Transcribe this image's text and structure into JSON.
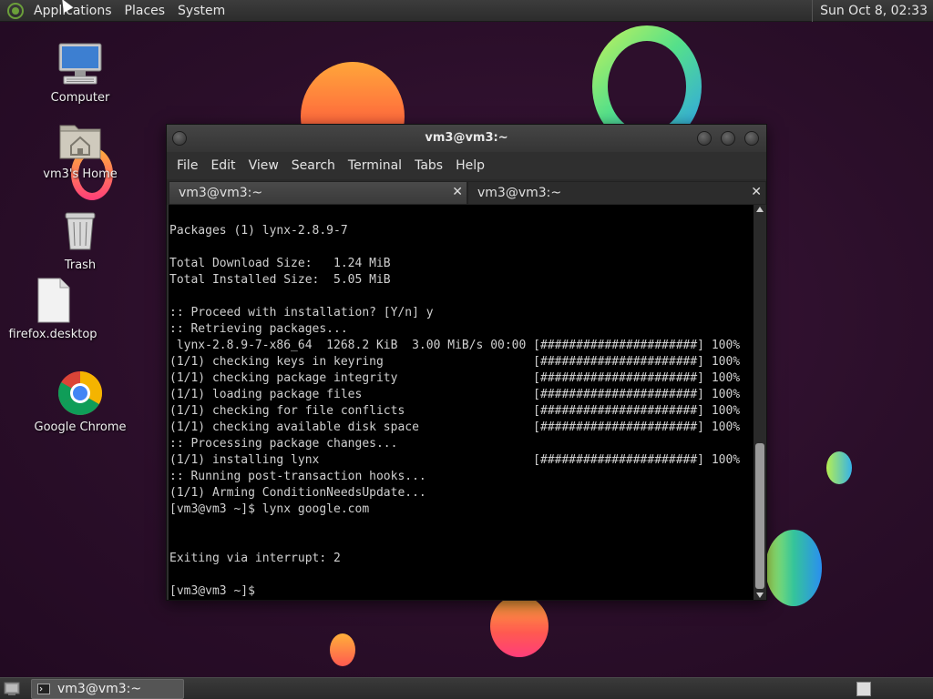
{
  "top_panel": {
    "menus": [
      "Applications",
      "Places",
      "System"
    ],
    "clock": "Sun Oct  8, 02:33"
  },
  "desktop_icons": [
    {
      "label": "Computer",
      "icon": "computer-icon"
    },
    {
      "label": "vm3's Home",
      "icon": "home-folder-icon"
    },
    {
      "label": "Trash",
      "icon": "trash-icon"
    },
    {
      "label": "firefox.desktop",
      "icon": "file-icon"
    },
    {
      "label": "Google Chrome",
      "icon": "chrome-icon"
    }
  ],
  "terminal": {
    "title": "vm3@vm3:~",
    "menus": [
      "File",
      "Edit",
      "View",
      "Search",
      "Terminal",
      "Tabs",
      "Help"
    ],
    "tabs": [
      {
        "label": "vm3@vm3:~",
        "active": true
      },
      {
        "label": "vm3@vm3:~",
        "active": false
      }
    ],
    "lines": [
      "",
      "Packages (1) lynx-2.8.9-7",
      "",
      "Total Download Size:   1.24 MiB",
      "Total Installed Size:  5.05 MiB",
      "",
      ":: Proceed with installation? [Y/n] y",
      ":: Retrieving packages...",
      " lynx-2.8.9-7-x86_64  1268.2 KiB  3.00 MiB/s 00:00 [######################] 100%",
      "(1/1) checking keys in keyring                     [######################] 100%",
      "(1/1) checking package integrity                   [######################] 100%",
      "(1/1) loading package files                        [######################] 100%",
      "(1/1) checking for file conflicts                  [######################] 100%",
      "(1/1) checking available disk space                [######################] 100%",
      ":: Processing package changes...",
      "(1/1) installing lynx                              [######################] 100%",
      ":: Running post-transaction hooks...",
      "(1/1) Arming ConditionNeedsUpdate...",
      "[vm3@vm3 ~]$ lynx google.com",
      "",
      "",
      "Exiting via interrupt: 2",
      "",
      "[vm3@vm3 ~]$ "
    ]
  },
  "taskbar": {
    "window_button": "vm3@vm3:~"
  },
  "colors": {
    "terminal_bg": "#000000",
    "terminal_fg": "#d0d0d0",
    "panel_bg": "#333333",
    "wallpaper": "#2a0e29"
  }
}
